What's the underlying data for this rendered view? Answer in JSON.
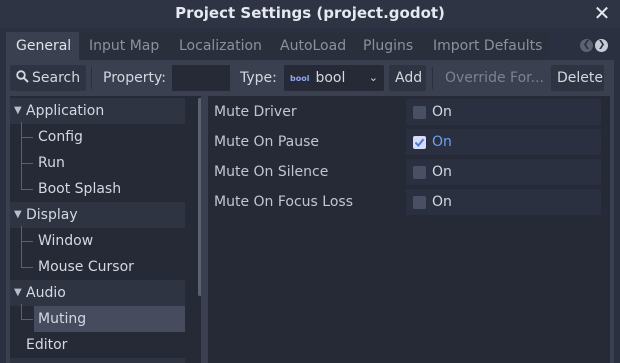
{
  "window": {
    "title": "Project Settings (project.godot)",
    "close_icon": "✕"
  },
  "tabs": [
    {
      "label": "General"
    },
    {
      "label": "Input Map"
    },
    {
      "label": "Localization"
    },
    {
      "label": "AutoLoad"
    },
    {
      "label": "Plugins"
    },
    {
      "label": "Import Defaults"
    }
  ],
  "toolbar": {
    "search_label": "Search",
    "property_label": "Property:",
    "property_value": "",
    "type_label": "Type:",
    "type_icon": "bool",
    "type_value": "bool",
    "add_label": "Add",
    "override_label": "Override For...",
    "delete_label": "Delete"
  },
  "tree": [
    {
      "label": "Application",
      "kind": "section"
    },
    {
      "label": "Config",
      "kind": "item"
    },
    {
      "label": "Run",
      "kind": "item"
    },
    {
      "label": "Boot Splash",
      "kind": "item"
    },
    {
      "label": "Display",
      "kind": "section"
    },
    {
      "label": "Window",
      "kind": "item"
    },
    {
      "label": "Mouse Cursor",
      "kind": "item"
    },
    {
      "label": "Audio",
      "kind": "section"
    },
    {
      "label": "Muting",
      "kind": "item",
      "selected": true
    },
    {
      "label": "Editor",
      "kind": "section-collapsed"
    }
  ],
  "properties": [
    {
      "name": "Mute Driver",
      "value_label": "On",
      "checked": false
    },
    {
      "name": "Mute On Pause",
      "value_label": "On",
      "checked": true
    },
    {
      "name": "Mute On Silence",
      "value_label": "On",
      "checked": false
    },
    {
      "name": "Mute On Focus Loss",
      "value_label": "On",
      "checked": false
    }
  ],
  "colors": {
    "accent": "#6e9ff2",
    "background": "#2b3040",
    "panel": "#3a4050",
    "field": "#262a36"
  }
}
